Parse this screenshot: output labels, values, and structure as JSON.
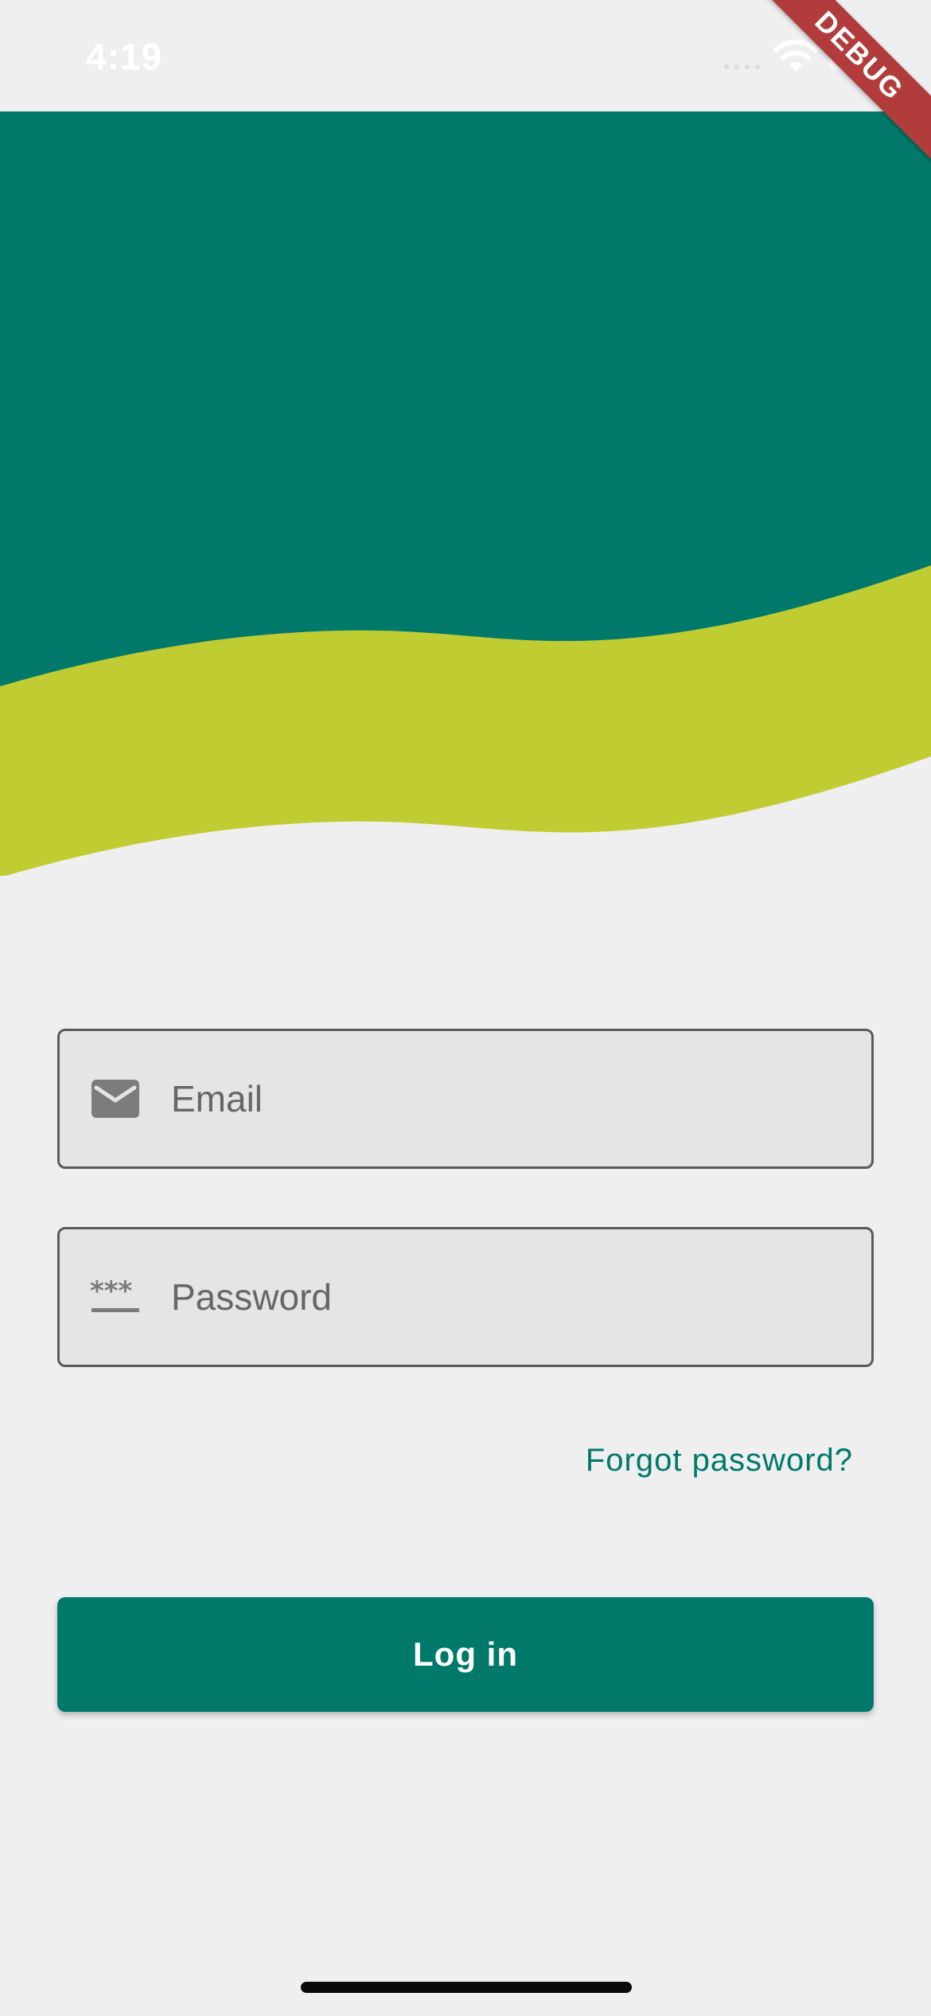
{
  "status_bar": {
    "time": "4:19"
  },
  "debug_banner": {
    "label": "DEBUG"
  },
  "colors": {
    "primary": "#00796b",
    "accent": "#c0cd32",
    "background": "#efefef",
    "banner": "#b23b3b"
  },
  "form": {
    "email": {
      "placeholder": "Email",
      "value": "",
      "icon": "email-icon"
    },
    "password": {
      "placeholder": "Password",
      "value": "",
      "icon": "password-icon"
    },
    "forgot_label": "Forgot password?",
    "login_label": "Log in"
  }
}
